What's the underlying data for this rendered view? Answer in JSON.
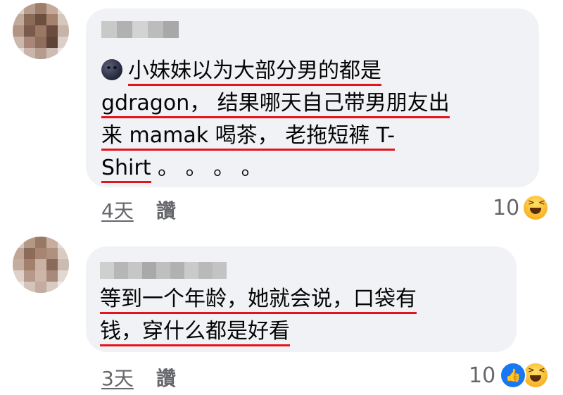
{
  "comments": [
    {
      "lines": [
        "小妹妹以为大部分男的都是",
        "gdragon， 结果哪天自己带男朋友出",
        "来 mamak 喝茶， 老拖短裤 T-",
        "Shirt"
      ],
      "trailing": " 。 。 。 。",
      "time": "4天",
      "like_label": "讚",
      "reaction_count": "10",
      "reactions": [
        "haha-icon"
      ]
    },
    {
      "lines": [
        "等到一个年龄，她就会说，口袋有",
        "钱，穿什么都是好看"
      ],
      "time": "3天",
      "like_label": "讚",
      "reaction_count": "10",
      "reactions": [
        "like-icon",
        "haha-icon"
      ]
    }
  ],
  "colors": {
    "bubble": "#f0f2f5",
    "underline": "#e4141b",
    "meta": "#65676b",
    "like": "#1877f2"
  }
}
